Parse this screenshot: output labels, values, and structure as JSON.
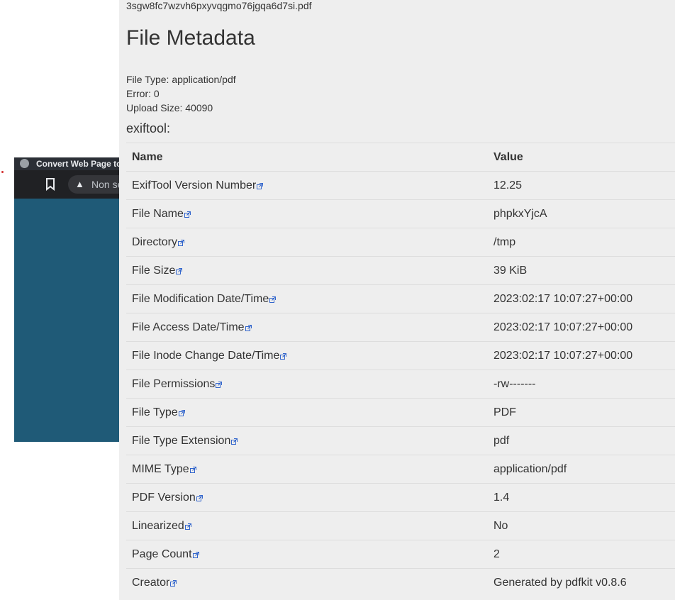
{
  "background_window": {
    "title": "Convert Web Page to",
    "url_text": "Non se"
  },
  "file": {
    "name": "3sgw8fc7wzvh6pxyvqgmo76jgqa6d7si.pdf"
  },
  "page": {
    "title": "File Metadata",
    "file_type_line": "File Type: application/pdf",
    "error_line": "Error: 0",
    "upload_size_line": "Upload Size: 40090",
    "section": "exiftool:"
  },
  "table": {
    "headers": [
      "Name",
      "Value"
    ],
    "rows": [
      {
        "name": "ExifTool Version Number",
        "value": "12.25"
      },
      {
        "name": "File Name",
        "value": "phpkxYjcA"
      },
      {
        "name": "Directory",
        "value": "/tmp"
      },
      {
        "name": "File Size",
        "value": "39 KiB"
      },
      {
        "name": "File Modification Date/Time",
        "value": "2023:02:17 10:07:27+00:00"
      },
      {
        "name": "File Access Date/Time",
        "value": "2023:02:17 10:07:27+00:00"
      },
      {
        "name": "File Inode Change Date/Time",
        "value": "2023:02:17 10:07:27+00:00"
      },
      {
        "name": "File Permissions",
        "value": "-rw-------"
      },
      {
        "name": "File Type",
        "value": "PDF"
      },
      {
        "name": "File Type Extension",
        "value": "pdf"
      },
      {
        "name": "MIME Type",
        "value": "application/pdf"
      },
      {
        "name": "PDF Version",
        "value": "1.4"
      },
      {
        "name": "Linearized",
        "value": "No"
      },
      {
        "name": "Page Count",
        "value": "2"
      },
      {
        "name": "Creator",
        "value": "Generated by pdfkit v0.8.6"
      }
    ]
  },
  "colors": {
    "panel_bg": "#eeeeee",
    "text": "#333333",
    "link_icon": "#3366cc",
    "embedded_bg": "#1f5a77"
  }
}
